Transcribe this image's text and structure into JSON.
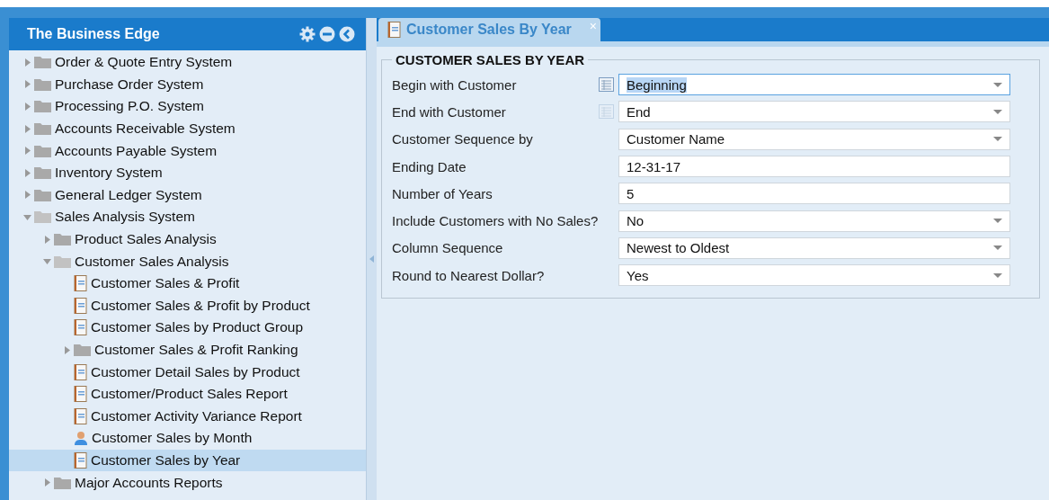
{
  "sidebar": {
    "title": "The Business Edge",
    "items": [
      {
        "label": "Order & Quote Entry System",
        "kind": "folder",
        "expanded": false,
        "selected": false
      },
      {
        "label": "Purchase Order System",
        "kind": "folder",
        "expanded": false,
        "selected": false
      },
      {
        "label": "Processing P.O. System",
        "kind": "folder",
        "expanded": false,
        "selected": false
      },
      {
        "label": "Accounts Receivable System",
        "kind": "folder",
        "expanded": false,
        "selected": false
      },
      {
        "label": "Accounts Payable System",
        "kind": "folder",
        "expanded": false,
        "selected": false
      },
      {
        "label": "Inventory System",
        "kind": "folder",
        "expanded": false,
        "selected": false
      },
      {
        "label": "General Ledger System",
        "kind": "folder",
        "expanded": false,
        "selected": false
      },
      {
        "label": "Sales Analysis System",
        "kind": "folder",
        "expanded": true,
        "selected": false,
        "children": [
          {
            "label": "Product Sales Analysis",
            "kind": "folder",
            "expanded": false,
            "selected": false
          },
          {
            "label": "Customer Sales Analysis",
            "kind": "folder",
            "expanded": true,
            "selected": false,
            "children": [
              {
                "label": "Customer Sales & Profit",
                "kind": "report",
                "selected": false
              },
              {
                "label": "Customer Sales & Profit by Product",
                "kind": "report",
                "selected": false
              },
              {
                "label": "Customer Sales by Product Group",
                "kind": "report",
                "selected": false
              },
              {
                "label": "Customer Sales & Profit Ranking",
                "kind": "folder",
                "expanded": false,
                "selected": false
              },
              {
                "label": "Customer Detail Sales by Product",
                "kind": "report",
                "selected": false
              },
              {
                "label": "Customer/Product Sales Report",
                "kind": "report",
                "selected": false
              },
              {
                "label": "Customer Activity Variance Report",
                "kind": "report",
                "selected": false
              },
              {
                "label": "Customer Sales by Month",
                "kind": "person",
                "selected": false
              },
              {
                "label": "Customer Sales by Year",
                "kind": "report",
                "selected": true
              }
            ]
          },
          {
            "label": "Major Accounts Reports",
            "kind": "folder",
            "expanded": false,
            "selected": false
          }
        ]
      }
    ]
  },
  "tab": {
    "label": "Customer Sales By Year",
    "close": "×"
  },
  "form": {
    "title": "CUSTOMER SALES BY YEAR",
    "fields": [
      {
        "label": "Begin with Customer",
        "value": "Beginning",
        "kind": "dropdown",
        "lookup": true,
        "lookup_enabled": true,
        "focused": true
      },
      {
        "label": "End with Customer",
        "value": "End",
        "kind": "dropdown",
        "lookup": true,
        "lookup_enabled": false,
        "focused": false
      },
      {
        "label": "Customer Sequence by",
        "value": "Customer Name",
        "kind": "dropdown",
        "focused": false
      },
      {
        "label": "Ending Date",
        "value": "12-31-17",
        "kind": "text",
        "focused": false
      },
      {
        "label": "Number of Years",
        "value": "5",
        "kind": "text",
        "focused": false
      },
      {
        "label": "Include Customers with No Sales?",
        "value": "No",
        "kind": "dropdown",
        "focused": false
      },
      {
        "label": "Column Sequence",
        "value": "Newest to Oldest",
        "kind": "dropdown",
        "focused": false
      },
      {
        "label": "Round to Nearest Dollar?",
        "value": "Yes",
        "kind": "dropdown",
        "focused": false
      }
    ]
  }
}
